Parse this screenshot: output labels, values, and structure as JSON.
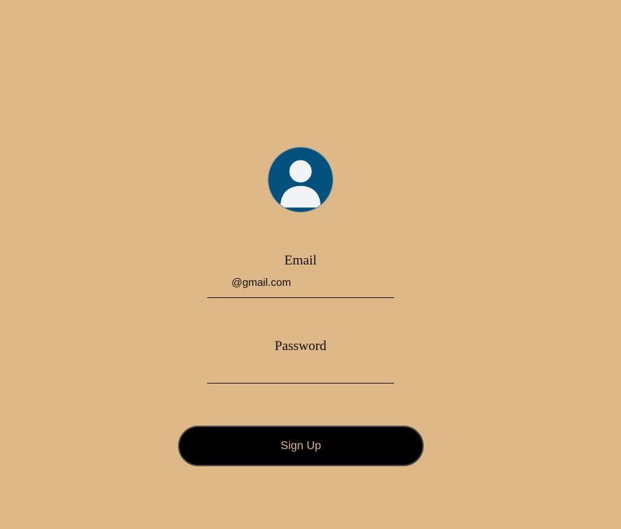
{
  "avatar": {
    "icon": "user-avatar-icon",
    "background_color": "#03527e"
  },
  "form": {
    "email": {
      "label": "Email",
      "value": "",
      "placeholder": "@gmail.com"
    },
    "password": {
      "label": "Password",
      "value": "",
      "placeholder": ""
    },
    "submit_label": "Sign Up"
  },
  "colors": {
    "background": "#deb887",
    "button_bg": "#000000",
    "button_text": "#deb887"
  }
}
